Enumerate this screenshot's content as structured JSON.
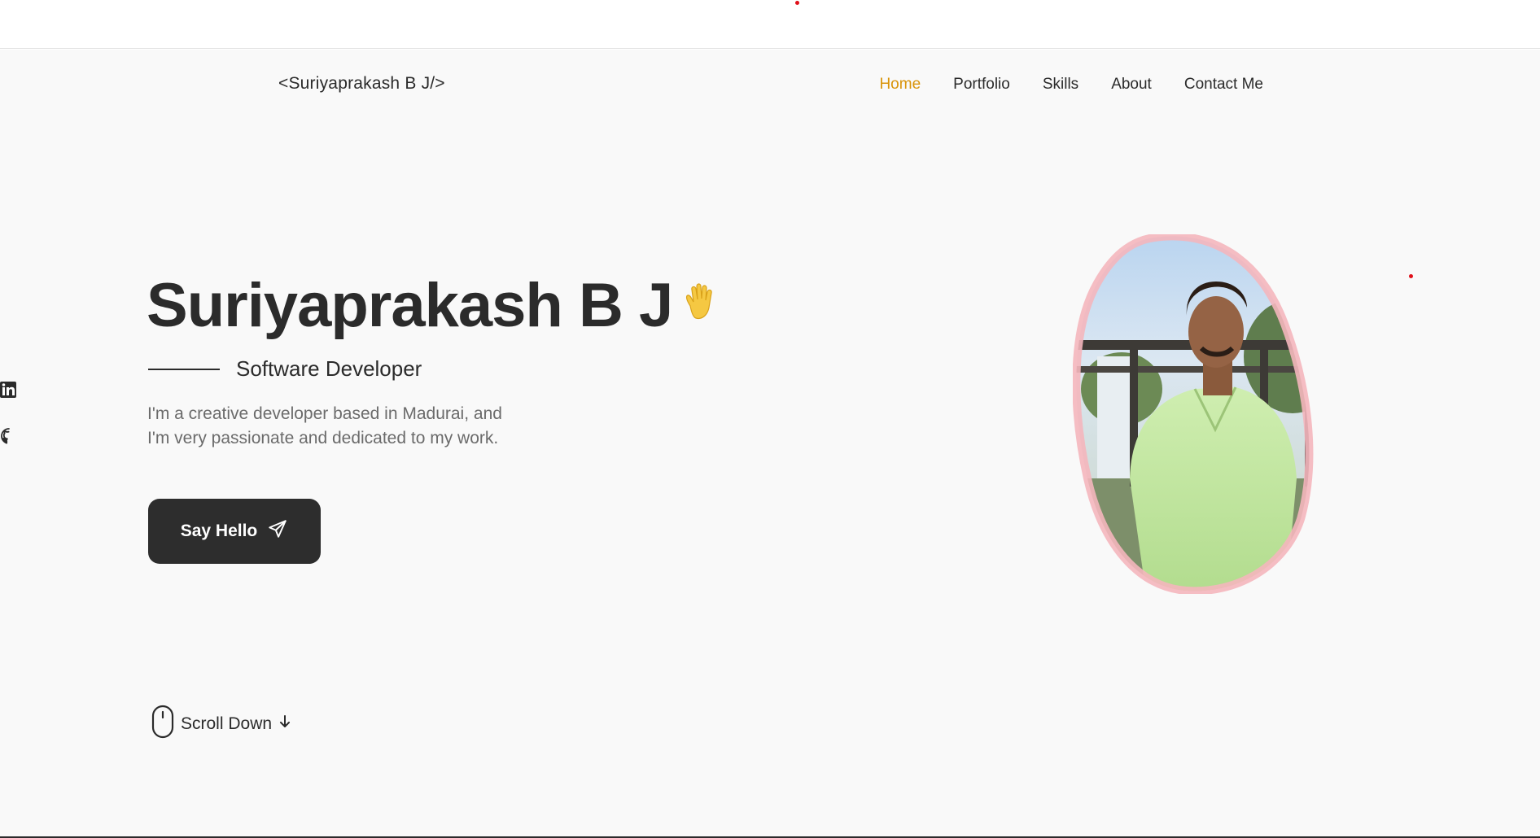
{
  "header": {
    "logo": "<Suriyaprakash B J/>",
    "nav": [
      {
        "label": "Home",
        "active": true
      },
      {
        "label": "Portfolio",
        "active": false
      },
      {
        "label": "Skills",
        "active": false
      },
      {
        "label": "About",
        "active": false
      },
      {
        "label": "Contact Me",
        "active": false
      }
    ]
  },
  "hero": {
    "name": "Suriyaprakash B J",
    "wave_icon": "waving-hand-icon",
    "subtitle": "Software Developer",
    "description_line1": "I'm a creative developer based in Madurai, and",
    "description_line2": "I'm very passionate and dedicated to my work.",
    "cta_label": "Say Hello",
    "cta_icon": "send-icon",
    "scroll_label": "Scroll Down",
    "scroll_icon": "mouse-icon"
  },
  "social": [
    {
      "name": "linkedin-icon"
    },
    {
      "name": "github-icon"
    }
  ],
  "colors": {
    "accent": "#d9940a",
    "text": "#2b2b2b",
    "muted": "#6b6b6b",
    "background": "#f9f9f9",
    "button": "#2d2d2d",
    "blob_border": "#f4b6bc",
    "marker": "#e0101a"
  }
}
